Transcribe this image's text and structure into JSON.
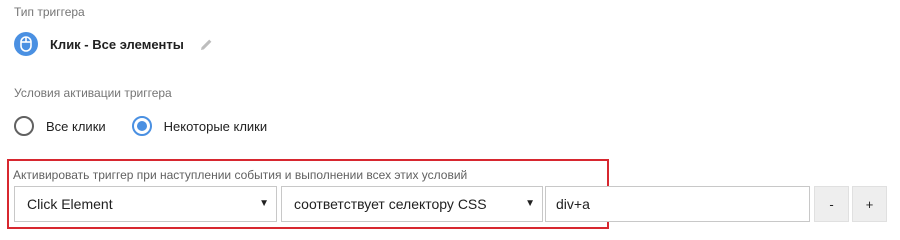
{
  "trigger_type": {
    "section_label": "Тип триггера",
    "name": "Клик - Все элементы",
    "icon": "mouse-icon",
    "accent_color": "#4a90e2"
  },
  "conditions": {
    "section_label": "Условия активации триггера",
    "options": [
      {
        "label": "Все клики",
        "selected": false
      },
      {
        "label": "Некоторые клики",
        "selected": true
      }
    ]
  },
  "filter": {
    "caption": "Активировать триггер при наступлении события и выполнении всех этих условий",
    "highlight_color": "#d7272f",
    "variable": "Click Element",
    "operator": "соответствует селектору CSS",
    "value": "div+a",
    "remove_label": "-",
    "add_label": "+"
  }
}
